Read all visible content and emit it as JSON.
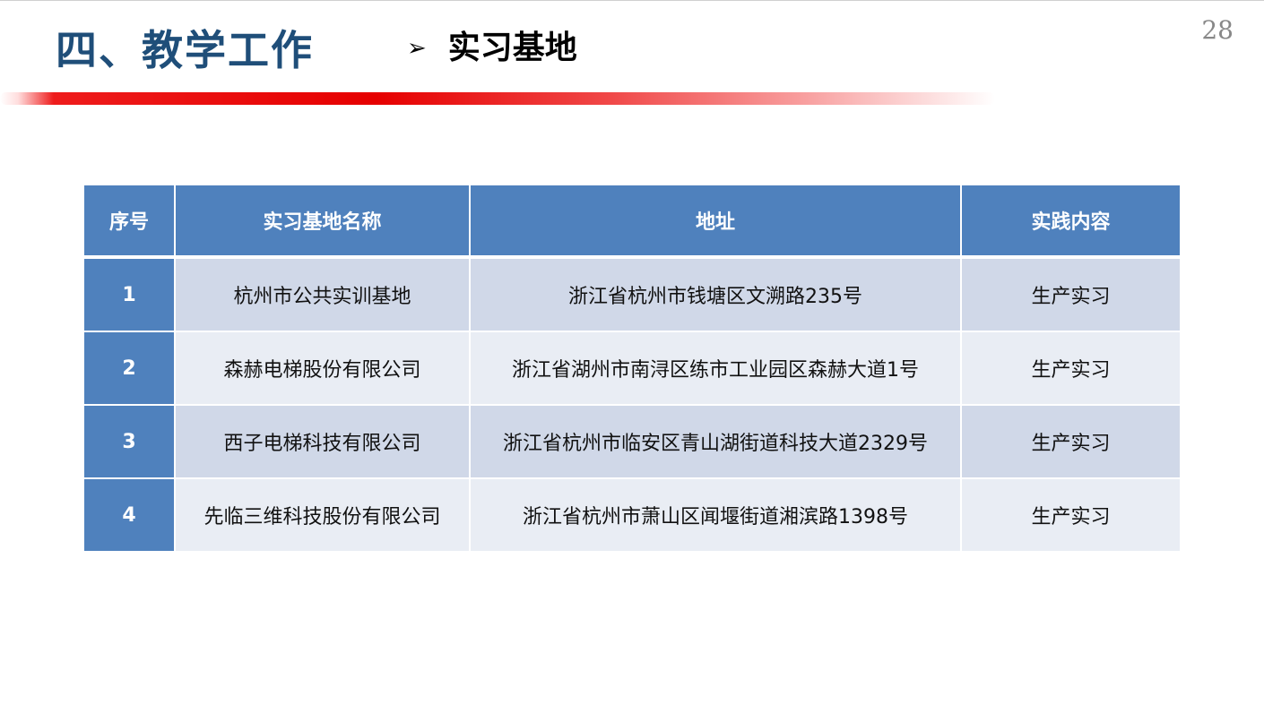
{
  "header": {
    "section_title": "四、教学工作",
    "sub_title": "实习基地",
    "arrow_icon": "➢",
    "page_number": "28"
  },
  "colors": {
    "title_blue": "#1f4e79",
    "accent_red": "#e60000",
    "table_header": "#4f81bd",
    "row_odd": "#d0d8e8",
    "row_even": "#e9edf4"
  },
  "table": {
    "headers": [
      "序号",
      "实习基地名称",
      "地址",
      "实践内容"
    ],
    "rows": [
      {
        "seq": "1",
        "name": "杭州市公共实训基地",
        "address": "浙江省杭州市钱塘区文溯路235号",
        "content": "生产实习"
      },
      {
        "seq": "2",
        "name": "森赫电梯股份有限公司",
        "address": "浙江省湖州市南浔区练市工业园区森赫大道1号",
        "content": "生产实习"
      },
      {
        "seq": "3",
        "name": "西子电梯科技有限公司",
        "address": "浙江省杭州市临安区青山湖街道科技大道2329号",
        "content": "生产实习"
      },
      {
        "seq": "4",
        "name": "先临三维科技股份有限公司",
        "address": "浙江省杭州市萧山区闻堰街道湘滨路1398号",
        "content": "生产实习"
      }
    ]
  }
}
